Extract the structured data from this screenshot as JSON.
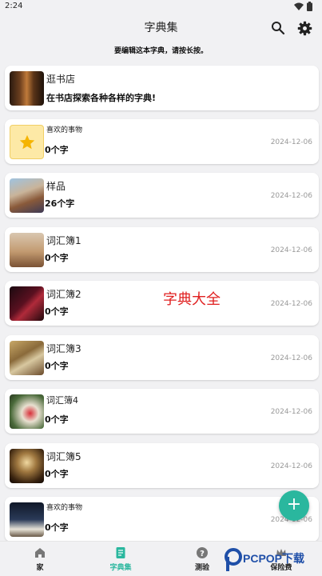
{
  "status_bar": {
    "time": "2:24"
  },
  "app_bar": {
    "title": "字典集",
    "search_icon": "search-icon",
    "settings_icon": "gear-icon"
  },
  "hint": "要编辑这本字典，请按长按。",
  "bookstore": {
    "name": "逛书店",
    "description": "在书店探索各种各样的字典!"
  },
  "dictionaries": [
    {
      "name": "喜欢的事物",
      "count": "0个字",
      "date": "2024-12-06"
    },
    {
      "name": "样品",
      "count": "26个字",
      "date": "2024-12-06"
    },
    {
      "name": "词汇簿1",
      "count": "0个字",
      "date": "2024-12-06"
    },
    {
      "name": "词汇簿2",
      "count": "0个字",
      "date": "2024-12-06"
    },
    {
      "name": "词汇簿3",
      "count": "0个字",
      "date": "2024-12-06"
    },
    {
      "name": "词汇簿4",
      "count": "0个字",
      "date": "2024-12-06"
    },
    {
      "name": "词汇簿5",
      "count": "0个字",
      "date": "2024-12-06"
    },
    {
      "name": "喜欢的事物",
      "count": "0个字",
      "date": "2024-12-06"
    }
  ],
  "watermark": "字典大全",
  "fab": {
    "label": "+"
  },
  "bottom_nav": [
    {
      "label": "家",
      "icon": "home-icon"
    },
    {
      "label": "字典集",
      "icon": "dictionary-icon",
      "active": true
    },
    {
      "label": "测验",
      "icon": "quiz-icon"
    },
    {
      "label": "保险费",
      "icon": "premium-icon"
    }
  ],
  "logo": {
    "text": "PCPOP下载"
  },
  "colors": {
    "accent": "#2ab79e",
    "background": "#f1f1f3",
    "watermark": "#e02020",
    "date": "#999999"
  }
}
